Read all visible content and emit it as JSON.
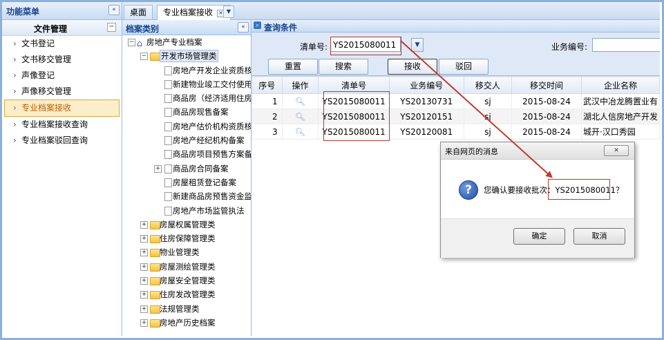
{
  "left_menu": {
    "title": "功能菜单",
    "collapse_glyph": "«",
    "group": {
      "title": "文件管理",
      "toggle": "−"
    },
    "items": [
      {
        "label": "文书登记"
      },
      {
        "label": "文书移交管理"
      },
      {
        "label": "声像登记"
      },
      {
        "label": "声像移交管理"
      },
      {
        "label": "专业档案接收",
        "selected": true
      },
      {
        "label": "专业档案接收查询"
      },
      {
        "label": "专业档案驳回查询"
      }
    ]
  },
  "tabs": [
    {
      "label": "桌面"
    },
    {
      "label": "专业档案接收",
      "active": true
    }
  ],
  "tree_panel": {
    "title": "档案类别",
    "collapse_glyph": "«",
    "root": "房地产专业档案",
    "nodes": [
      {
        "label": "开发市场管理类",
        "selected": true
      },
      {
        "label": "房地产开发企业资质核准"
      },
      {
        "label": "新建物业竣工交付使用备案"
      },
      {
        "label": "商品房（经济适用住房）"
      },
      {
        "label": "商品房现售备案"
      },
      {
        "label": "房地产估价机构资质核准"
      },
      {
        "label": "房地产经纪机构备案"
      },
      {
        "label": "商品房项目预售方案备案"
      },
      {
        "label": "商品房合同备案"
      },
      {
        "label": "房屋租赁登记备案"
      },
      {
        "label": "新建商品房预售资金监管"
      },
      {
        "label": "房地产市场监管执法"
      },
      {
        "label": "房屋权属管理类"
      },
      {
        "label": "住房保障管理类"
      },
      {
        "label": "物业管理类"
      },
      {
        "label": "房屋测绘管理类"
      },
      {
        "label": "房屋安全管理类"
      },
      {
        "label": "住房发改管理类"
      },
      {
        "label": "法规管理类"
      },
      {
        "label": "房地产历史档案"
      }
    ]
  },
  "query": {
    "title": "查询条件",
    "list_no_label": "清单号:",
    "list_no_value": "YS2015080011",
    "business_no_label": "业务编号:",
    "business_no_value": "",
    "buttons": {
      "reset": "重置",
      "search": "搜索",
      "receive": "接收",
      "reject": "驳回"
    }
  },
  "grid": {
    "columns": [
      "序号",
      "操作",
      "清单号",
      "业务编号",
      "移交人",
      "移交时间",
      "企业名称"
    ],
    "rows": [
      {
        "idx": "1",
        "list_no": "YS2015080011",
        "business_no": "YS20130731",
        "transferor": "sj",
        "date": "2015-08-24",
        "company": "武汉中冶龙腾置业有"
      },
      {
        "idx": "2",
        "list_no": "YS2015080011",
        "business_no": "YS20120151",
        "transferor": "sj",
        "date": "2015-08-24",
        "company": "湖北人信房地产开发"
      },
      {
        "idx": "3",
        "list_no": "YS2015080011",
        "business_no": "YS20120081",
        "transferor": "sj",
        "date": "2015-08-24",
        "company": "城开·汉口秀园"
      }
    ]
  },
  "dialog": {
    "title": "来自网页的消息",
    "close_glyph": "✕",
    "question_glyph": "?",
    "message_prefix": "您确认要接收批次：",
    "message_value": "YS2015080011？",
    "ok_label": "确定",
    "cancel_label": "取消"
  },
  "annotation_color": "#c0392b"
}
